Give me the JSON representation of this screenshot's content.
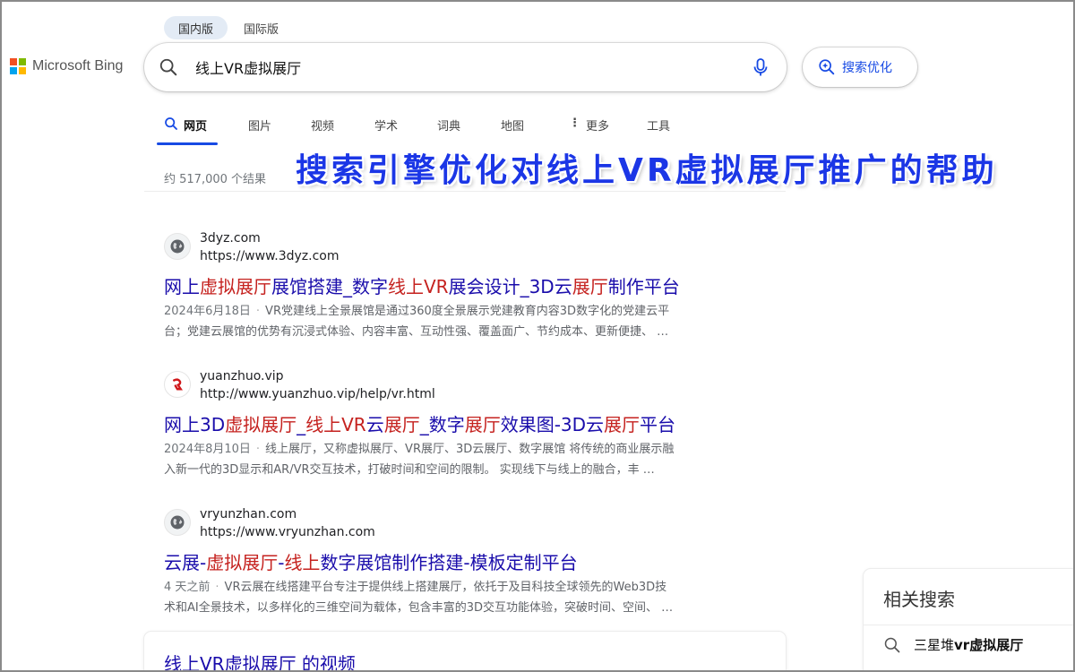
{
  "region_tabs": {
    "domestic": "国内版",
    "international": "国际版"
  },
  "logo": {
    "text": "Microsoft Bing"
  },
  "search": {
    "query": "线上VR虚拟展厅"
  },
  "seo_button": {
    "label": "搜索优化"
  },
  "nav": {
    "web": "网页",
    "images": "图片",
    "videos": "视频",
    "academic": "学术",
    "dictionary": "词典",
    "maps": "地图",
    "more": "更多",
    "tools": "工具"
  },
  "result_count": "约 517,000 个结果",
  "overlay_title": "搜索引擎优化对线上VR虚拟展厅推广的帮助",
  "results": [
    {
      "site": "3dyz.com",
      "url": "https://www.3dyz.com",
      "title_parts": [
        "网上",
        "虚拟展厅",
        "展馆搭建_数字",
        "线上",
        "VR",
        "展会设计_3D云",
        "展厅",
        "制作平台"
      ],
      "date": "2024年6月18日",
      "snippet_1": "VR党建线上全景展馆是通过360度全景展示党建教育内容3D数字化的党建云平",
      "snippet_2": "台；党建云展馆的优势有沉浸式体验、内容丰富、互动性强、覆盖面广、节约成本、更新便捷、 …"
    },
    {
      "site": "yuanzhuo.vip",
      "url": "http://www.yuanzhuo.vip/help/vr.html",
      "title_parts": [
        "网上3D",
        "虚拟展厅",
        "_",
        "线上VR",
        "云",
        "展厅",
        "_数字",
        "展厅",
        "效果图-3D云",
        "展厅",
        "平台"
      ],
      "date": "2024年8月10日",
      "snippet_1": "线上展厅，又称虚拟展厅、VR展厅、3D云展厅、数字展馆 将传统的商业展示融",
      "snippet_2": "入新一代的3D显示和AR/VR交互技术，打破时间和空间的限制。 实现线下与线上的融合，丰 …"
    },
    {
      "site": "vryunzhan.com",
      "url": "https://www.vryunzhan.com",
      "title_parts": [
        "云展-",
        "虚拟展厅",
        "-",
        "线上",
        "数字展馆制作搭建-模板定制平台"
      ],
      "date": "4 天之前",
      "snippet_1": "VR云展在线搭建平台专注于提供线上搭建展厅，依托于及目科技全球领先的Web3D技",
      "snippet_2": "术和AI全景技术，以多样化的三维空间为载体，包含丰富的3D交互功能体验，突破时间、空间、 …"
    }
  ],
  "video_section": {
    "title": "线上VR虚拟展厅 的视频"
  },
  "related": {
    "title": "相关搜索",
    "item_prefix": "三星堆",
    "item_bold": "vr虚拟展厅"
  },
  "colors": {
    "accent": "#174ae4",
    "link": "#1a0dab",
    "highlight": "#c5221f",
    "overlay": "#1b36e6"
  }
}
